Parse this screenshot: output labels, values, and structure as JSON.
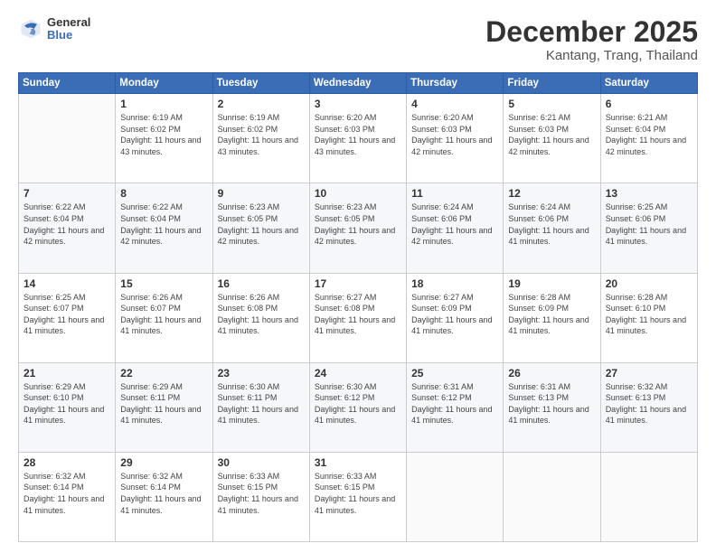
{
  "logo": {
    "general": "General",
    "blue": "Blue"
  },
  "header": {
    "month": "December 2025",
    "location": "Kantang, Trang, Thailand"
  },
  "days_of_week": [
    "Sunday",
    "Monday",
    "Tuesday",
    "Wednesday",
    "Thursday",
    "Friday",
    "Saturday"
  ],
  "weeks": [
    [
      {
        "day": "",
        "sunrise": "",
        "sunset": "",
        "daylight": ""
      },
      {
        "day": "1",
        "sunrise": "Sunrise: 6:19 AM",
        "sunset": "Sunset: 6:02 PM",
        "daylight": "Daylight: 11 hours and 43 minutes."
      },
      {
        "day": "2",
        "sunrise": "Sunrise: 6:19 AM",
        "sunset": "Sunset: 6:02 PM",
        "daylight": "Daylight: 11 hours and 43 minutes."
      },
      {
        "day": "3",
        "sunrise": "Sunrise: 6:20 AM",
        "sunset": "Sunset: 6:03 PM",
        "daylight": "Daylight: 11 hours and 43 minutes."
      },
      {
        "day": "4",
        "sunrise": "Sunrise: 6:20 AM",
        "sunset": "Sunset: 6:03 PM",
        "daylight": "Daylight: 11 hours and 42 minutes."
      },
      {
        "day": "5",
        "sunrise": "Sunrise: 6:21 AM",
        "sunset": "Sunset: 6:03 PM",
        "daylight": "Daylight: 11 hours and 42 minutes."
      },
      {
        "day": "6",
        "sunrise": "Sunrise: 6:21 AM",
        "sunset": "Sunset: 6:04 PM",
        "daylight": "Daylight: 11 hours and 42 minutes."
      }
    ],
    [
      {
        "day": "7",
        "sunrise": "Sunrise: 6:22 AM",
        "sunset": "Sunset: 6:04 PM",
        "daylight": "Daylight: 11 hours and 42 minutes."
      },
      {
        "day": "8",
        "sunrise": "Sunrise: 6:22 AM",
        "sunset": "Sunset: 6:04 PM",
        "daylight": "Daylight: 11 hours and 42 minutes."
      },
      {
        "day": "9",
        "sunrise": "Sunrise: 6:23 AM",
        "sunset": "Sunset: 6:05 PM",
        "daylight": "Daylight: 11 hours and 42 minutes."
      },
      {
        "day": "10",
        "sunrise": "Sunrise: 6:23 AM",
        "sunset": "Sunset: 6:05 PM",
        "daylight": "Daylight: 11 hours and 42 minutes."
      },
      {
        "day": "11",
        "sunrise": "Sunrise: 6:24 AM",
        "sunset": "Sunset: 6:06 PM",
        "daylight": "Daylight: 11 hours and 42 minutes."
      },
      {
        "day": "12",
        "sunrise": "Sunrise: 6:24 AM",
        "sunset": "Sunset: 6:06 PM",
        "daylight": "Daylight: 11 hours and 41 minutes."
      },
      {
        "day": "13",
        "sunrise": "Sunrise: 6:25 AM",
        "sunset": "Sunset: 6:06 PM",
        "daylight": "Daylight: 11 hours and 41 minutes."
      }
    ],
    [
      {
        "day": "14",
        "sunrise": "Sunrise: 6:25 AM",
        "sunset": "Sunset: 6:07 PM",
        "daylight": "Daylight: 11 hours and 41 minutes."
      },
      {
        "day": "15",
        "sunrise": "Sunrise: 6:26 AM",
        "sunset": "Sunset: 6:07 PM",
        "daylight": "Daylight: 11 hours and 41 minutes."
      },
      {
        "day": "16",
        "sunrise": "Sunrise: 6:26 AM",
        "sunset": "Sunset: 6:08 PM",
        "daylight": "Daylight: 11 hours and 41 minutes."
      },
      {
        "day": "17",
        "sunrise": "Sunrise: 6:27 AM",
        "sunset": "Sunset: 6:08 PM",
        "daylight": "Daylight: 11 hours and 41 minutes."
      },
      {
        "day": "18",
        "sunrise": "Sunrise: 6:27 AM",
        "sunset": "Sunset: 6:09 PM",
        "daylight": "Daylight: 11 hours and 41 minutes."
      },
      {
        "day": "19",
        "sunrise": "Sunrise: 6:28 AM",
        "sunset": "Sunset: 6:09 PM",
        "daylight": "Daylight: 11 hours and 41 minutes."
      },
      {
        "day": "20",
        "sunrise": "Sunrise: 6:28 AM",
        "sunset": "Sunset: 6:10 PM",
        "daylight": "Daylight: 11 hours and 41 minutes."
      }
    ],
    [
      {
        "day": "21",
        "sunrise": "Sunrise: 6:29 AM",
        "sunset": "Sunset: 6:10 PM",
        "daylight": "Daylight: 11 hours and 41 minutes."
      },
      {
        "day": "22",
        "sunrise": "Sunrise: 6:29 AM",
        "sunset": "Sunset: 6:11 PM",
        "daylight": "Daylight: 11 hours and 41 minutes."
      },
      {
        "day": "23",
        "sunrise": "Sunrise: 6:30 AM",
        "sunset": "Sunset: 6:11 PM",
        "daylight": "Daylight: 11 hours and 41 minutes."
      },
      {
        "day": "24",
        "sunrise": "Sunrise: 6:30 AM",
        "sunset": "Sunset: 6:12 PM",
        "daylight": "Daylight: 11 hours and 41 minutes."
      },
      {
        "day": "25",
        "sunrise": "Sunrise: 6:31 AM",
        "sunset": "Sunset: 6:12 PM",
        "daylight": "Daylight: 11 hours and 41 minutes."
      },
      {
        "day": "26",
        "sunrise": "Sunrise: 6:31 AM",
        "sunset": "Sunset: 6:13 PM",
        "daylight": "Daylight: 11 hours and 41 minutes."
      },
      {
        "day": "27",
        "sunrise": "Sunrise: 6:32 AM",
        "sunset": "Sunset: 6:13 PM",
        "daylight": "Daylight: 11 hours and 41 minutes."
      }
    ],
    [
      {
        "day": "28",
        "sunrise": "Sunrise: 6:32 AM",
        "sunset": "Sunset: 6:14 PM",
        "daylight": "Daylight: 11 hours and 41 minutes."
      },
      {
        "day": "29",
        "sunrise": "Sunrise: 6:32 AM",
        "sunset": "Sunset: 6:14 PM",
        "daylight": "Daylight: 11 hours and 41 minutes."
      },
      {
        "day": "30",
        "sunrise": "Sunrise: 6:33 AM",
        "sunset": "Sunset: 6:15 PM",
        "daylight": "Daylight: 11 hours and 41 minutes."
      },
      {
        "day": "31",
        "sunrise": "Sunrise: 6:33 AM",
        "sunset": "Sunset: 6:15 PM",
        "daylight": "Daylight: 11 hours and 41 minutes."
      },
      {
        "day": "",
        "sunrise": "",
        "sunset": "",
        "daylight": ""
      },
      {
        "day": "",
        "sunrise": "",
        "sunset": "",
        "daylight": ""
      },
      {
        "day": "",
        "sunrise": "",
        "sunset": "",
        "daylight": ""
      }
    ]
  ]
}
